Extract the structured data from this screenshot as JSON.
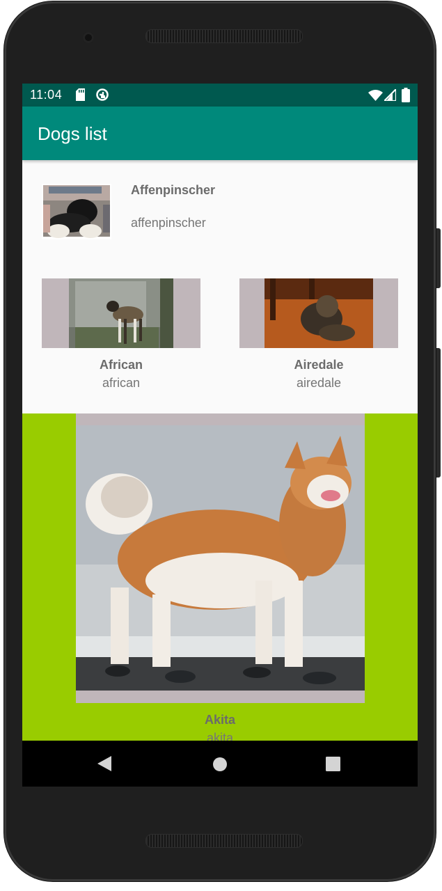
{
  "status_bar": {
    "time": "11:04"
  },
  "app_bar": {
    "title": "Dogs list"
  },
  "dogs": [
    {
      "name": "Affenpinscher",
      "subtitle": "affenpinscher"
    },
    {
      "name": "African",
      "subtitle": "african"
    },
    {
      "name": "Airedale",
      "subtitle": "airedale"
    },
    {
      "name": "Akita",
      "subtitle": "akita"
    }
  ],
  "colors": {
    "status_bar": "#00594f",
    "app_bar": "#00897b",
    "highlight_background": "#99cc00",
    "image_placeholder": "#c0b6ba"
  },
  "icons": {
    "status_left": [
      "sd-card-icon",
      "sync-icon"
    ],
    "status_right": [
      "wifi-icon",
      "signal-icon",
      "battery-icon"
    ],
    "navigation": [
      "back-icon",
      "home-icon",
      "recents-icon"
    ]
  }
}
